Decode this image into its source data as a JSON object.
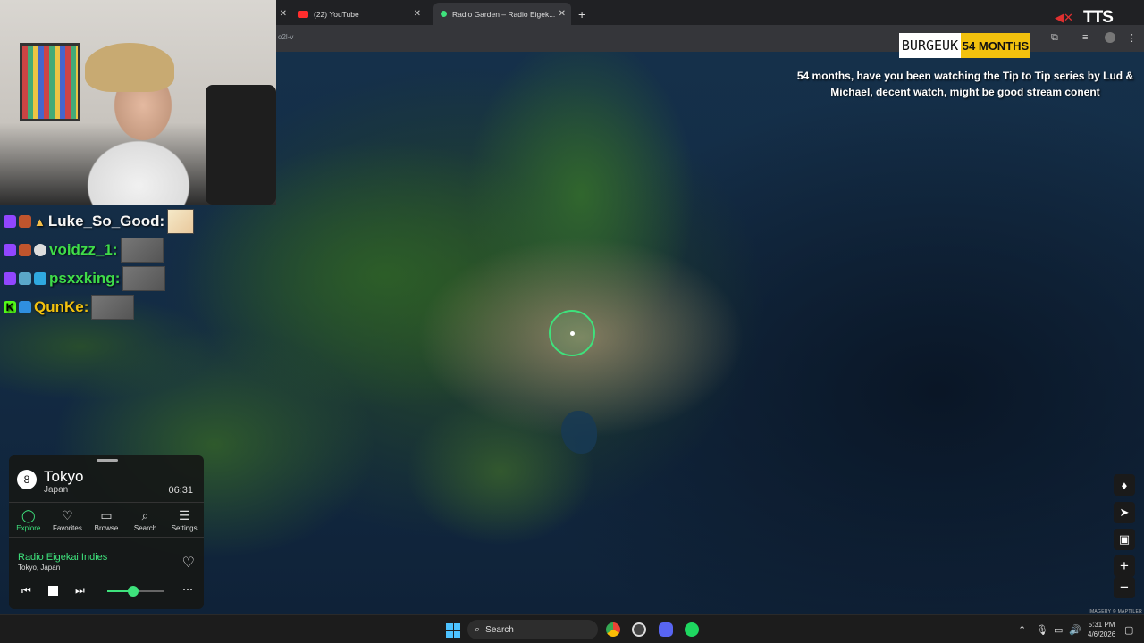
{
  "browser": {
    "tabs": [
      {
        "title": ""
      },
      {
        "title": "(22) YouTube"
      },
      {
        "title": "Radio Garden – Radio Eigek..."
      }
    ],
    "new_tab_symbol": "+",
    "url_fragment": "o2l-v"
  },
  "tts": {
    "label": "TTS"
  },
  "sub_alert": {
    "name": "BURGEUK",
    "months": "54 MONTHS",
    "message": "54 months, have you been watching the Tip to Tip series by Lud & Michael, decent watch, might be good stream conent"
  },
  "chat": [
    {
      "user": "Luke_So_Good:",
      "color": "#f5f5f5"
    },
    {
      "user": "voidzz_1:",
      "color": "#3fdc4a"
    },
    {
      "user": "psxxking:",
      "color": "#3fdc4a"
    },
    {
      "user": "QunKe:",
      "color": "#f2c10e"
    }
  ],
  "radio": {
    "station_count": "8",
    "city": "Tokyo",
    "country": "Japan",
    "local_time": "06:31",
    "nav": [
      {
        "label": "Explore",
        "icon": "explore-icon"
      },
      {
        "label": "Favorites",
        "icon": "heart-icon"
      },
      {
        "label": "Browse",
        "icon": "map-icon"
      },
      {
        "label": "Search",
        "icon": "search-icon"
      },
      {
        "label": "Settings",
        "icon": "menu-icon"
      }
    ],
    "station_name": "Radio Eigekai Indies",
    "station_location": "Tokyo, Japan",
    "volume": 0.45
  },
  "map": {
    "attribution": "IMAGERY © MAPTILER"
  },
  "taskbar": {
    "search_placeholder": "Search",
    "time": "5:31 PM",
    "date": "4/6/2026"
  },
  "colors": {
    "accent": "#3ee27c",
    "sub_gold": "#f2c10e"
  }
}
